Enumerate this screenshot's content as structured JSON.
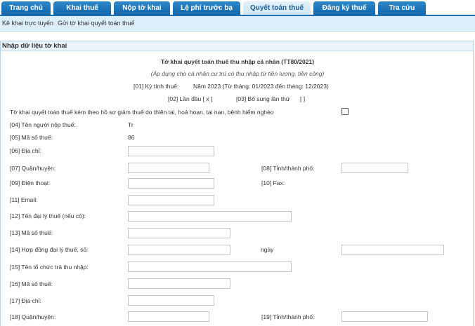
{
  "nav": {
    "tabs": [
      "Trang chủ",
      "Khai thuế",
      "Nộp tờ khai",
      "Lệ phí trước bạ",
      "Quyết toán thuế",
      "Đăng ký thuế",
      "Tra cứu"
    ]
  },
  "subnav": {
    "item1": "Kê khai trực tuyến",
    "item2": "Gửi tờ khai quyết toán thuế"
  },
  "panel": {
    "title": "Nhập dữ liệu tờ khai"
  },
  "form": {
    "title": "Tờ khai quyết toán thuế thu nhập cá nhân (TT80/2021)",
    "subtitle": "(Áp dụng cho cá nhân cư trú có thu nhập từ tiền lương, tiền công)",
    "period_label": "[01] Kỳ tính thuế:",
    "period_value": "Năm 2023 (Từ tháng: 01/2023 đến tháng: 12/2023)",
    "first_time": "[02] Lần đầu [ x ]",
    "supplement": "[03] Bổ sung lần thứ",
    "supplement_value": "[ ]",
    "disaster_text": "Tờ khai quyết toán thuế kèm theo hồ sơ giảm thuế do thiên tai, hoả hoạn, tai nạn, bệnh hiểm nghèo",
    "taxpayer_name_label": "[04] Tên người nộp thuế:",
    "taxpayer_name_value": "Tr",
    "tax_code_label": "[05] Mã số thuế:",
    "tax_code_value": "86",
    "address_label": "[06] Địa chỉ:",
    "district_label": "[07] Quận/huyện:",
    "province_label": "[08] Tỉnh/thành phố:",
    "phone_label": "[09] Điện thoại:",
    "fax_label": "[10] Fax:",
    "email_label": "[11] Email:",
    "agent_name_label": "[12] Tên đại lý thuế (nếu có):",
    "agent_tax_code_label": "[13] Mã số thuế:",
    "agent_contract_label": "[14] Hợp đồng đại lý thuế, số:",
    "date_label": "ngày",
    "payer_org_label": "[15] Tên tổ chức trả thu nhập:",
    "payer_tax_code_label": "[16] Mã số thuế:",
    "payer_address_label": "[17] Địa chỉ:",
    "payer_district_label": "[18] Quận/huyện:",
    "payer_province_label": "[19] Tỉnh/thành phố:"
  }
}
